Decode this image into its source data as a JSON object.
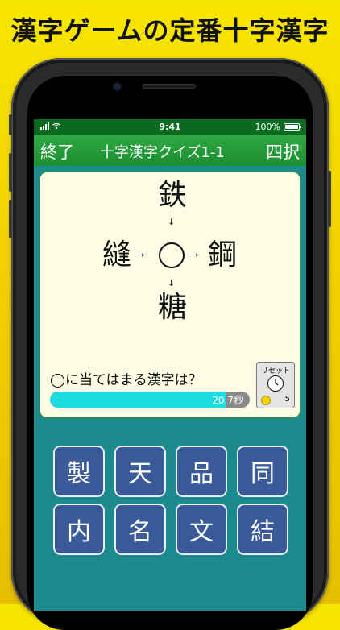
{
  "promo": {
    "title": "漢字ゲームの定番十字漢字"
  },
  "status_bar": {
    "time": "9:41",
    "battery": "100%"
  },
  "header": {
    "quit_label": "終了",
    "title": "十字漢字クイズ1-1",
    "mode": "四択"
  },
  "puzzle": {
    "top": "鉄",
    "left": "縫",
    "right": "鋼",
    "bottom": "糖",
    "arrow_down": "↓",
    "arrow_right": "→"
  },
  "question": {
    "text": "◯に当てはまる漢字は？"
  },
  "timer": {
    "text": "20.7秒",
    "fill_fraction": 0.88
  },
  "reset": {
    "label": "リセット",
    "count": "5"
  },
  "choices": [
    "製",
    "天",
    "品",
    "同",
    "内",
    "名",
    "文",
    "結"
  ],
  "colors": {
    "accent": "#1b8e30",
    "background": "#1c8b8e",
    "choice": "#3a5a9a",
    "promo_bg": "#f2d200"
  },
  "icons": [
    "signal-icon",
    "wifi-icon",
    "battery-icon",
    "clock-icon",
    "smile-icon"
  ]
}
